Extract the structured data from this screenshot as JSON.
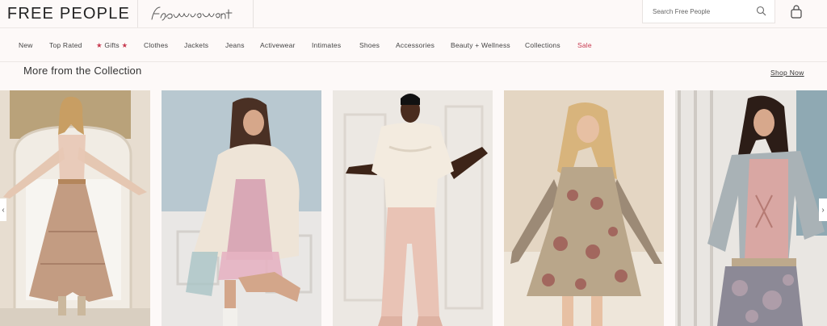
{
  "header": {
    "logo": "FREE PEOPLE",
    "secondary_logo": "fp movement",
    "search_placeholder": "Search Free People"
  },
  "nav": {
    "items": [
      {
        "label": "New"
      },
      {
        "label": "Top Rated"
      },
      {
        "label": "Gifts",
        "prefix": "★",
        "suffix": "★"
      },
      {
        "label": "Clothes"
      },
      {
        "label": "Jackets"
      },
      {
        "label": "Jeans"
      },
      {
        "label": "Activewear"
      },
      {
        "label": "Intimates"
      },
      {
        "label": "Shoes"
      },
      {
        "label": "Accessories"
      },
      {
        "label": "Beauty + Wellness"
      },
      {
        "label": "Collections"
      },
      {
        "label": "Sale"
      }
    ]
  },
  "section": {
    "title": "More from the Collection",
    "link": "Shop Now"
  },
  "colors": {
    "background": "#fdf9f8",
    "accent": "#c7384e",
    "text": "#333333"
  }
}
